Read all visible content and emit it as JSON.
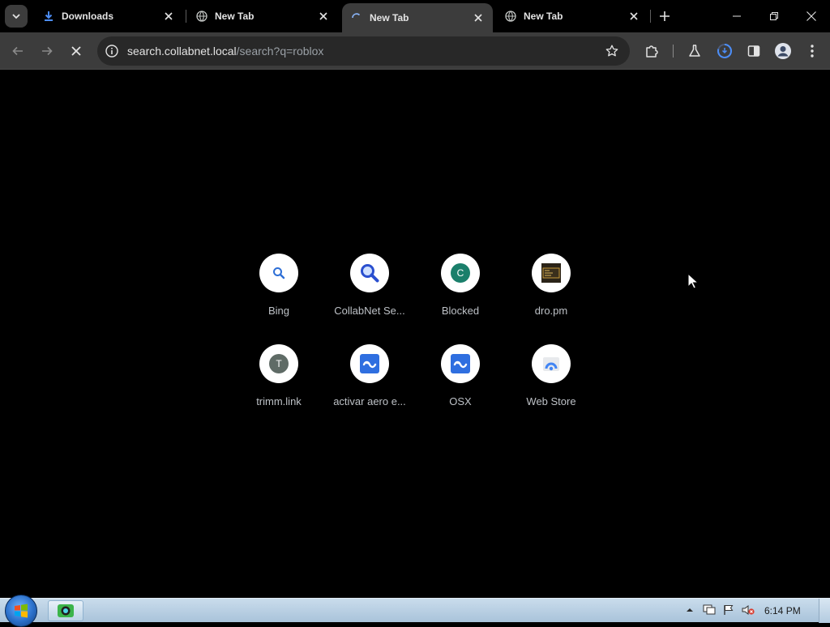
{
  "browser": {
    "tabs": [
      {
        "title": "Downloads",
        "icon": "download-icon"
      },
      {
        "title": "New Tab",
        "icon": "globe-icon"
      },
      {
        "title": "New Tab",
        "icon": "loading-spinner-icon",
        "active": true
      },
      {
        "title": "New Tab",
        "icon": "globe-icon"
      }
    ],
    "address": {
      "host": "search.collabnet.local",
      "path": "/search?q=roblox"
    }
  },
  "shortcuts": [
    {
      "label": "Bing",
      "icon": "bing-search-icon"
    },
    {
      "label": "CollabNet Se...",
      "icon": "magnifier-icon"
    },
    {
      "label": "Blocked",
      "icon": "letter-c-icon",
      "badge_letter": "C",
      "badge_color": "#1a7f6b"
    },
    {
      "label": "dro.pm",
      "icon": "dro-pm-favicon"
    },
    {
      "label": "trimm.link",
      "icon": "letter-t-icon",
      "badge_letter": "T",
      "badge_color": "#5f6b66"
    },
    {
      "label": "activar aero e...",
      "icon": "blue-logo-icon"
    },
    {
      "label": "OSX",
      "icon": "blue-logo-icon"
    },
    {
      "label": "Web Store",
      "icon": "web-store-icon"
    }
  ],
  "taskbar": {
    "clock": "6:14 PM"
  },
  "colors": {
    "accent_blue": "#1a73e8",
    "toolbar_bg": "#3c3c3c",
    "page_bg": "#000000"
  }
}
